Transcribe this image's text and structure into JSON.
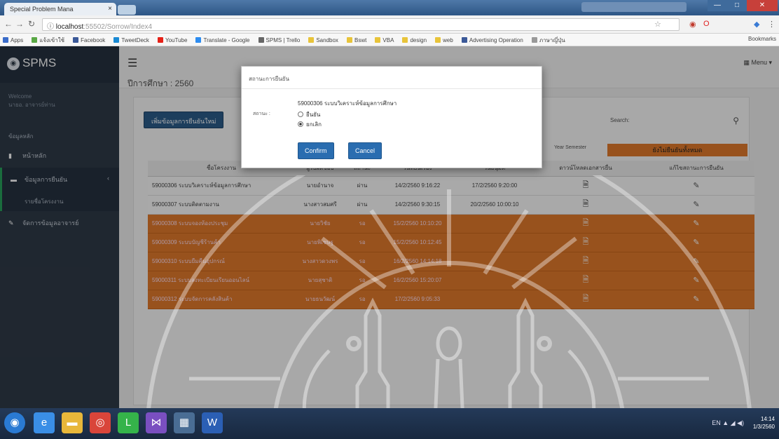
{
  "browser": {
    "tab_title": "Special Problem Mana",
    "tab_close": "×",
    "url_host": "localhost",
    "url_path": ":55502/Sorrow/Index4",
    "bookmarks": [
      "Apps",
      "แจ้งเข้าใช้",
      "Facebook",
      "TweetDeck",
      "YouTube",
      "Translate - Google",
      "SPMS | Trello",
      "Sandbox",
      "Bswt",
      "VBA",
      "design",
      "web",
      "Advertising Operation",
      "ภาษาญี่ปุ่น"
    ],
    "bookmark_colors": [
      "#3b6cc9",
      "#5aa845",
      "#3b5998",
      "#1a8ad4",
      "#e62117",
      "#2d8cf0",
      "#666666",
      "#e8c43a",
      "#e8c43a",
      "#e8c43a",
      "#e8c43a",
      "#e8c43a",
      "#3b5998",
      "#999999"
    ],
    "other_bookmarks": "Bookmarks",
    "window_controls": [
      "—",
      "□",
      "✕"
    ]
  },
  "sidebar": {
    "brand": "SPMS",
    "welcome_line1": "Welcome",
    "welcome_line2": "นายอ. อาจารย์ท่าน",
    "section_label": "ข้อมูลหลัก",
    "items": [
      {
        "label": "หน้าหลัก",
        "icon": "bookmark-icon"
      },
      {
        "label": "ข้อมูลการยืนยัน",
        "icon": "folder-icon",
        "chevron": "‹"
      },
      {
        "label": "รายชื่อโครงงาน",
        "icon": "",
        "sub": true
      },
      {
        "label": "จัดการข้อมูลอาจารย์",
        "icon": "edit-icon"
      }
    ]
  },
  "topbar": {
    "page_title": "ปีการศึกษา : 2560",
    "menu_label": "Menu"
  },
  "content": {
    "add_button": "เพิ่มข้อมูลการยืนยันใหม่",
    "search_label": "Search:",
    "filter_label": "Year Semester",
    "filter_value": "ยังไม่ยืนยันทั้งหมด",
    "columns": [
      "ชื่อโครงงาน",
      "ผู้รับผิดชอบ",
      "สถานะ",
      "วันที่ยื่นเรื่อง",
      "วันอนุมัติ",
      "ดาวน์โหลดเอกสารยื่น",
      "แก้ไขสถานะการยืนยัน"
    ],
    "rows": [
      {
        "name": "59000306 ระบบวิเคราะห์ข้อมูลการศึกษา",
        "owner": "นายอำนาจ",
        "status": "ผ่าน",
        "submitted": "14/2/2560 9:16:22",
        "approved": "17/2/2560 9:20:00",
        "style": "white"
      },
      {
        "name": "59000307 ระบบติดตามงาน",
        "owner": "นางสาวสมศรี",
        "status": "ผ่าน",
        "submitted": "14/2/2560 9:30:15",
        "approved": "20/2/2560 10:00:10",
        "style": "white"
      },
      {
        "name": "59000308 ระบบจองห้องประชุม",
        "owner": "นายวิชัย",
        "status": "รอ",
        "submitted": "15/2/2560 10:10:20",
        "approved": "",
        "style": "orange"
      },
      {
        "name": "59000309 ระบบบัญชีร้านค้า",
        "owner": "นายพิเชษฐ",
        "status": "รอ",
        "submitted": "15/2/2560 10:12:45",
        "approved": "",
        "style": "orange"
      },
      {
        "name": "59000310 ระบบยืมคืนอุปกรณ์",
        "owner": "นางสาวดวงพร",
        "status": "รอ",
        "submitted": "16/2/2560 14:14:18",
        "approved": "",
        "style": "orange"
      },
      {
        "name": "59000311 ระบบลงทะเบียนเรียนออนไลน์",
        "owner": "นายสุชาติ",
        "status": "รอ",
        "submitted": "16/2/2560 15:20:07",
        "approved": "",
        "style": "orange"
      },
      {
        "name": "59000312 ระบบจัดการคลังสินค้า",
        "owner": "นายธนวัฒน์",
        "status": "รอ",
        "submitted": "17/2/2560 9:05:33",
        "approved": "",
        "style": "orange"
      }
    ]
  },
  "modal": {
    "title": "สถานะการยืนยัน",
    "message": "59000306 ระบบวิเคราะห์ข้อมูลการศึกษา",
    "field_label": "สถานะ :",
    "options": [
      "ยืนยัน",
      "ยกเลิก"
    ],
    "selected": 1,
    "confirm": "Confirm",
    "cancel": "Cancel"
  },
  "taskbar": {
    "apps": [
      "start-orb-icon",
      "ie-icon",
      "folder-icon",
      "chrome-icon",
      "line-icon",
      "visual-studio-icon",
      "photos-icon",
      "word-icon"
    ],
    "app_glyphs": [
      "◉",
      "e",
      "▬",
      "◎",
      "L",
      "⋈",
      "▦",
      "W"
    ],
    "app_colors": [
      "#2a7ad3",
      "#3a8ee6",
      "#e8b73a",
      "#d9453a",
      "#35b34a",
      "#7a4fc0",
      "#4a6d94",
      "#2b5fb4"
    ],
    "tray_text": "EN ▲ ◢ ◀)",
    "time": "14:14",
    "date": "1/3/2560"
  }
}
